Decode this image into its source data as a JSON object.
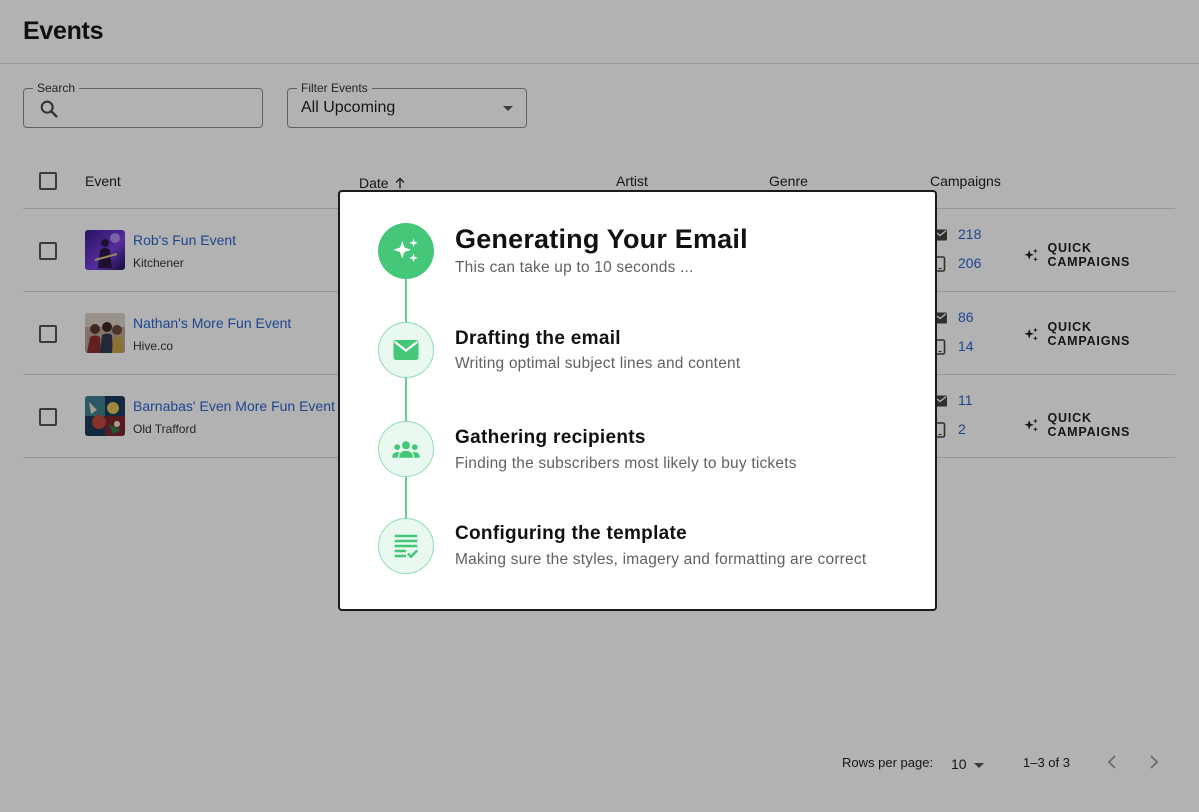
{
  "page": {
    "title": "Events"
  },
  "search": {
    "label": "Search",
    "placeholder": ""
  },
  "filter": {
    "label": "Filter Events",
    "value": "All Upcoming"
  },
  "table": {
    "headers": {
      "event": "Event",
      "date": "Date",
      "artist": "Artist",
      "genre": "Genre",
      "campaigns": "Campaigns"
    },
    "rows": [
      {
        "name": "Rob's Fun Event",
        "venue": "Kitchener",
        "email_count": "218",
        "sms_count": "206",
        "action": "QUICK CAMPAIGNS"
      },
      {
        "name": "Nathan's More Fun Event",
        "venue": "Hive.co",
        "email_count": "86",
        "sms_count": "14",
        "action": "QUICK CAMPAIGNS"
      },
      {
        "name": "Barnabas' Even More Fun Event",
        "venue": "Old Trafford",
        "email_count": "11",
        "sms_count": "2",
        "action": "QUICK CAMPAIGNS"
      }
    ]
  },
  "pagination": {
    "rows_per_page_label": "Rows per page:",
    "rows_per_page": "10",
    "range": "1–3 of 3"
  },
  "modal": {
    "title": "Generating Your Email",
    "subtitle": "This can take up to 10 seconds ...",
    "steps": [
      {
        "title": "Drafting the email",
        "description": "Writing optimal subject lines and content",
        "icon": "mail-icon"
      },
      {
        "title": "Gathering recipients",
        "description": "Finding the subscribers most likely to buy tickets",
        "icon": "groups-icon"
      },
      {
        "title": "Configuring the template",
        "description": "Making sure the styles, imagery and formatting are correct",
        "icon": "checklist-icon"
      }
    ]
  },
  "colors": {
    "accent_green": "#45c779",
    "link_blue": "#2b64cf",
    "overlay": "rgba(0,0,0,0.30)"
  }
}
